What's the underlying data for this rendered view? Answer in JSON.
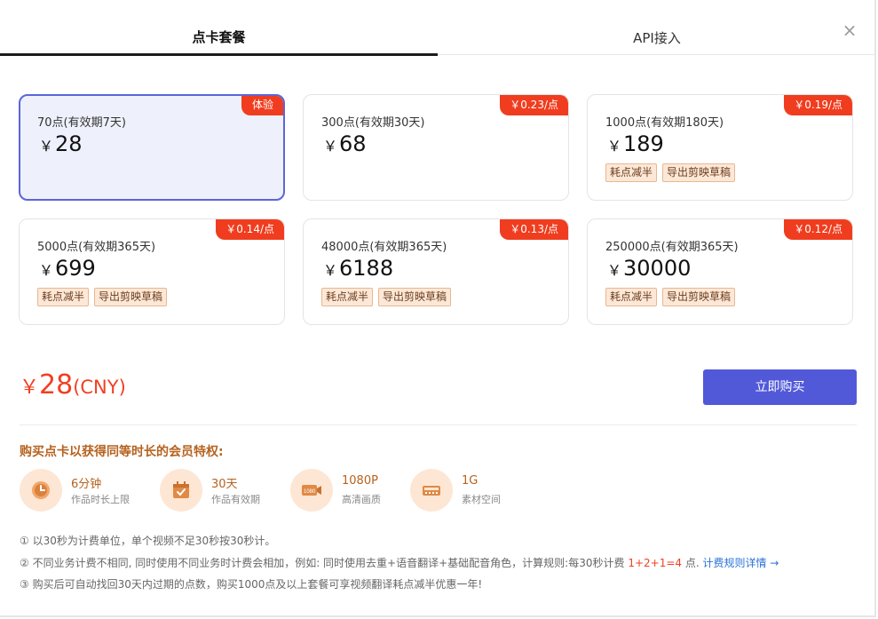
{
  "tabs": {
    "active": "点卡套餐",
    "inactive": "API接入"
  },
  "close_symbol": "×",
  "packages": [
    {
      "name": "70点(有效期7天)",
      "yen": "￥",
      "price": "28",
      "badge": "体验",
      "tags": []
    },
    {
      "name": "300点(有效期30天)",
      "yen": "￥",
      "price": "68",
      "badge": "￥0.23/点",
      "tags": []
    },
    {
      "name": "1000点(有效期180天)",
      "yen": "￥",
      "price": "189",
      "badge": "￥0.19/点",
      "tags": [
        "耗点减半",
        "导出剪映草稿"
      ]
    },
    {
      "name": "5000点(有效期365天)",
      "yen": "￥",
      "price": "699",
      "badge": "￥0.14/点",
      "tags": [
        "耗点减半",
        "导出剪映草稿"
      ]
    },
    {
      "name": "48000点(有效期365天)",
      "yen": "￥",
      "price": "6188",
      "badge": "￥0.13/点",
      "tags": [
        "耗点减半",
        "导出剪映草稿"
      ]
    },
    {
      "name": "250000点(有效期365天)",
      "yen": "￥",
      "price": "30000",
      "badge": "￥0.12/点",
      "tags": [
        "耗点减半",
        "导出剪映草稿"
      ]
    }
  ],
  "selected_index": 0,
  "total": {
    "yen": "￥",
    "amount": "28",
    "currency": "(CNY)"
  },
  "buy_label": "立即购买",
  "benefits_title": "购买点卡以获得同等时长的会员特权:",
  "benefits": [
    {
      "icon": "clock-icon",
      "value": "6分钟",
      "label": "作品时长上限"
    },
    {
      "icon": "calendar-check-icon",
      "value": "30天",
      "label": "作品有效期"
    },
    {
      "icon": "video-1080-icon",
      "value": "1080P",
      "label": "高清画质"
    },
    {
      "icon": "storage-icon",
      "value": "1G",
      "label": "素材空间"
    }
  ],
  "notes": {
    "n1": "① 以30秒为计费单位，单个视频不足30秒按30秒计。",
    "n2_prefix": "② 不同业务计费不相同, 同时使用不同业务时计费会相加，例如: 同时使用去重+语音翻译+基础配音角色，计算规则:每30秒计费 ",
    "n2_formula": "1+2+1=4",
    "n2_suffix": " 点. ",
    "n2_link": "计费规则详情 →",
    "n3": "③ 购买后可自动找回30天内过期的点数，购买1000点及以上套餐可享视频翻译耗点减半优惠一年!"
  },
  "colors": {
    "accent": "#5159d9",
    "price_red": "#f13f22",
    "badge_red": "#f03d1f",
    "gold": "#b5621f",
    "link": "#2a72d6"
  }
}
